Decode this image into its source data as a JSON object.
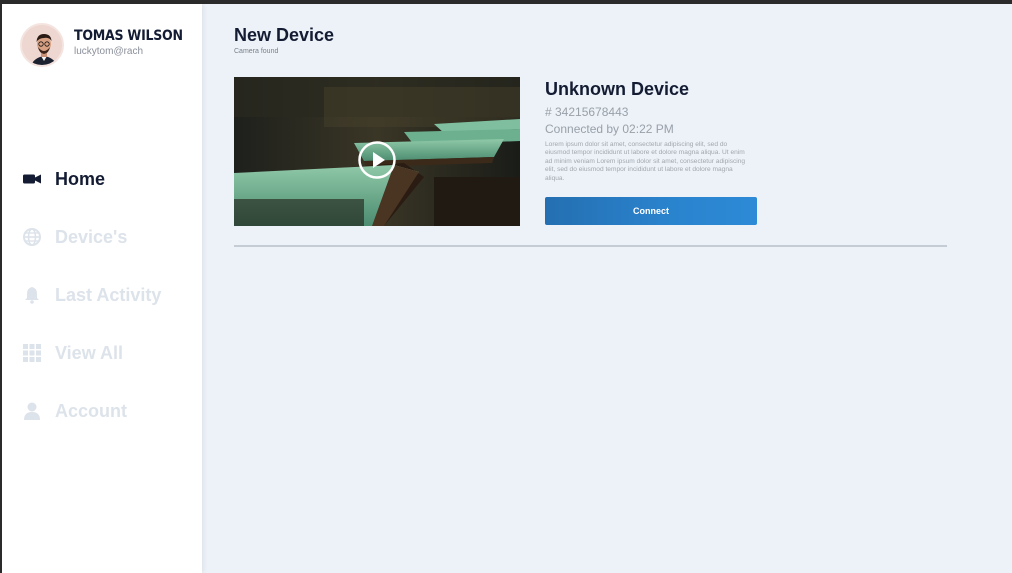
{
  "user": {
    "name": "TOMAS WILSON",
    "email": "luckytom@rach"
  },
  "nav": {
    "items": [
      {
        "label": "Home",
        "icon": "video-camera-icon",
        "active": true
      },
      {
        "label": "Device's",
        "icon": "globe-icon",
        "active": false
      },
      {
        "label": "Last Activity",
        "icon": "bell-icon",
        "active": false
      },
      {
        "label": "View All",
        "icon": "grid-icon",
        "active": false
      },
      {
        "label": "Account",
        "icon": "user-icon",
        "active": false
      }
    ]
  },
  "page": {
    "title": "New Device",
    "subtitle": "Camera found"
  },
  "device": {
    "name": "Unknown Device",
    "id": "# 34215678443",
    "connected": "Connected by 02:22 PM",
    "description": "Lorem ipsum dolor sit amet, consectetur adipiscing elit, sed do eiusmod tempor incididunt ut labore et dolore magna aliqua. Ut enim ad minim veniam Lorem ipsum dolor sit amet, consectetur adipiscing elit, sed do eiusmod tempor incididunt ut labore et dolore magna aliqua.",
    "connect_label": "Connect",
    "preview_icon": "play-icon"
  },
  "colors": {
    "accent": "#2a7cc4",
    "text_dark": "#141c33",
    "nav_inactive": "#dde3ea",
    "background": "#ecf2f8"
  }
}
